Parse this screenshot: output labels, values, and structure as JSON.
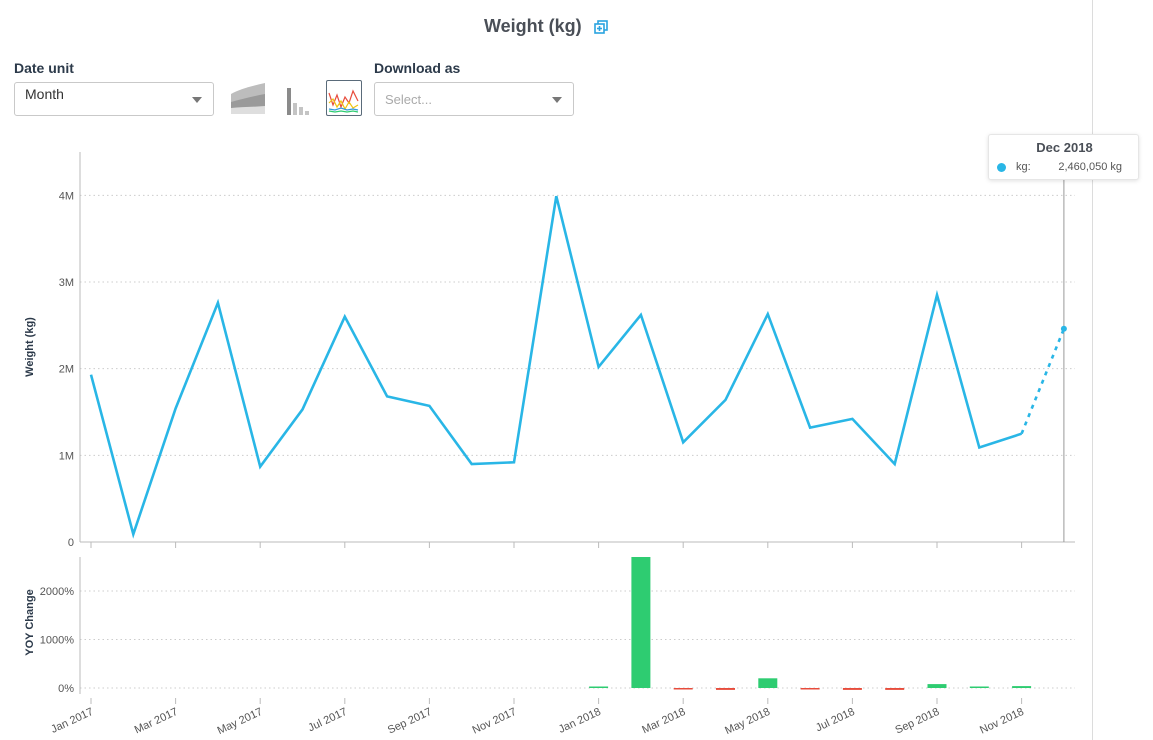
{
  "header": {
    "title": "Weight (kg)",
    "expand_icon": "expand-window-icon"
  },
  "controls": {
    "date_unit_label": "Date unit",
    "date_unit_value": "Month",
    "download_label": "Download as",
    "download_placeholder": "Select...",
    "chart_type_buttons": [
      "area-chart-icon",
      "bar-chart-icon",
      "line-chart-icon"
    ],
    "active_chart_type": "line-chart-icon"
  },
  "colors": {
    "line": "#29b6e6",
    "increase": "#2ecc71",
    "decrease": "#e74c3c",
    "grid": "#cccccc",
    "axis": "#bbbbbb"
  },
  "tooltip": {
    "title": "Dec 2018",
    "key": "kg:",
    "value": "2,460,050 kg"
  },
  "chart_data": [
    {
      "type": "line",
      "ylabel": "Weight (kg)",
      "ylim": [
        0,
        4500000
      ],
      "yticks": [
        0,
        1000000,
        2000000,
        3000000,
        4000000
      ],
      "ytick_labels": [
        "0",
        "1M",
        "2M",
        "3M",
        "4M"
      ],
      "x": [
        "Jan 2017",
        "Feb 2017",
        "Mar 2017",
        "Apr 2017",
        "May 2017",
        "Jun 2017",
        "Jul 2017",
        "Aug 2017",
        "Sep 2017",
        "Oct 2017",
        "Nov 2017",
        "Dec 2017",
        "Jan 2018",
        "Feb 2018",
        "Mar 2018",
        "Apr 2018",
        "May 2018",
        "Jun 2018",
        "Jul 2018",
        "Aug 2018",
        "Sep 2018",
        "Oct 2018",
        "Nov 2018",
        "Dec 2018"
      ],
      "xtick_labels": [
        "Jan 2017",
        "Mar 2017",
        "May 2017",
        "Jul 2017",
        "Sep 2017",
        "Nov 2017",
        "Jan 2018",
        "Mar 2018",
        "May 2018",
        "Jul 2018",
        "Sep 2018",
        "Nov 2018"
      ],
      "series": [
        {
          "values": [
            1930000,
            90000,
            1540000,
            2760000,
            870000,
            1530000,
            2600000,
            1680000,
            1570000,
            900000,
            920000,
            3990000,
            2020000,
            2620000,
            1150000,
            1640000,
            2630000,
            1320000,
            1420000,
            900000,
            2850000,
            1090000,
            1250000,
            2460050
          ]
        }
      ],
      "incomplete_last_point": true,
      "grid": true
    },
    {
      "type": "bar",
      "ylabel": "YOY Change",
      "ylim": [
        0,
        2700
      ],
      "yticks": [
        0,
        1000,
        2000
      ],
      "ytick_labels": [
        "0%",
        "1000%",
        "2000%"
      ],
      "x": [
        "Jan 2018",
        "Feb 2018",
        "Mar 2018",
        "Apr 2018",
        "May 2018",
        "Jun 2018",
        "Jul 2018",
        "Aug 2018",
        "Sep 2018",
        "Oct 2018",
        "Nov 2018"
      ],
      "values": [
        5,
        2700,
        -20,
        -40,
        200,
        -10,
        -40,
        -40,
        80,
        20,
        40
      ],
      "grid": true
    }
  ]
}
